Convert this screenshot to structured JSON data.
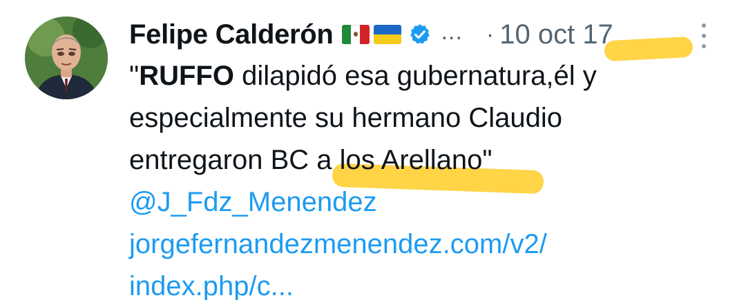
{
  "tweet": {
    "author": "Felipe Calderón",
    "flags": [
      "mexico-flag-icon",
      "ukraine-flag-icon"
    ],
    "verified_icon": "verified-badge-icon",
    "ellipsis": "...",
    "dot": "·",
    "date": "10 oct 17",
    "more_icon": "more-vertical-icon",
    "lines": [
      {
        "open_quote": "\"",
        "bold": "RUFFO",
        "rest": " dilapidó esa gubernatura,él y"
      },
      {
        "text": "especialmente su hermano Claudio"
      },
      {
        "text": "entregaron BC a los Arellano\""
      }
    ],
    "mention": "@J_Fdz_Menendez",
    "url_line1": "jorgefernandezmenendez.com/v2/",
    "url_line2": "index.php/c..."
  },
  "colors": {
    "text": "#0f1419",
    "muted": "#536471",
    "link": "#1d9bf0",
    "highlight": "#ffc400"
  }
}
